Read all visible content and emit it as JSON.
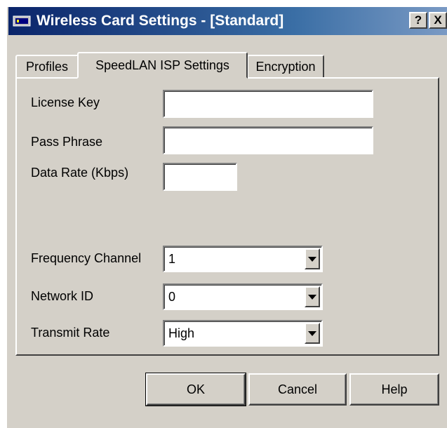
{
  "window": {
    "title": "Wireless Card Settings - [Standard]",
    "help_button": "?",
    "close_button": "X"
  },
  "tabs": [
    {
      "label": "Profiles"
    },
    {
      "label": "SpeedLAN ISP Settings",
      "active": true
    },
    {
      "label": "Encryption"
    }
  ],
  "form": {
    "license_key": {
      "label": "License Key",
      "value": ""
    },
    "pass_phrase": {
      "label": "Pass Phrase",
      "value": ""
    },
    "data_rate": {
      "label": "Data Rate (Kbps)",
      "value": ""
    },
    "frequency_channel": {
      "label": "Frequency Channel",
      "value": "1"
    },
    "network_id": {
      "label": "Network ID",
      "value": "0"
    },
    "transmit_rate": {
      "label": "Transmit Rate",
      "value": "High"
    }
  },
  "buttons": {
    "ok": "OK",
    "cancel": "Cancel",
    "help": "Help"
  }
}
